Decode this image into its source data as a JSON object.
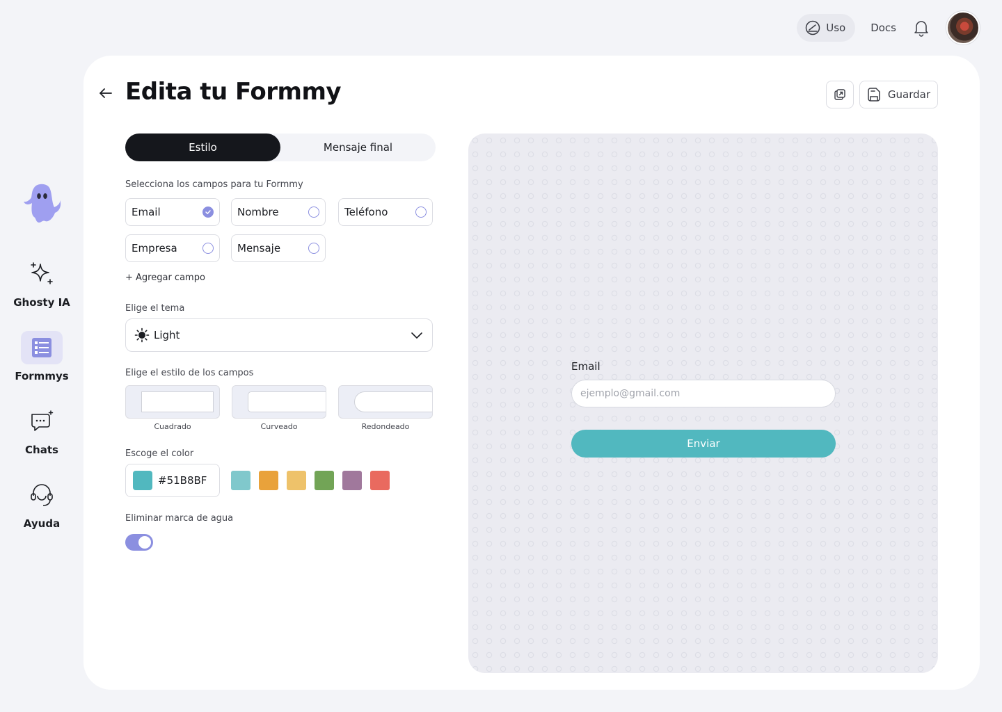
{
  "topbar": {
    "uso_label": "Uso",
    "docs_label": "Docs"
  },
  "sidebar": {
    "items": [
      {
        "label": "Ghosty IA",
        "icon": "sparkles-icon"
      },
      {
        "label": "Formmys",
        "icon": "list-icon",
        "active": true
      },
      {
        "label": "Chats",
        "icon": "chat-icon"
      },
      {
        "label": "Ayuda",
        "icon": "headset-icon"
      }
    ]
  },
  "header": {
    "title": "Edita tu Formmy",
    "save_label": "Guardar"
  },
  "tabs": [
    {
      "label": "Estilo",
      "active": true
    },
    {
      "label": "Mensaje final",
      "active": false
    }
  ],
  "fields": {
    "label": "Selecciona los campos para tu Formmy",
    "options": [
      {
        "label": "Email",
        "checked": true
      },
      {
        "label": "Nombre",
        "checked": false
      },
      {
        "label": "Teléfono",
        "checked": false
      },
      {
        "label": "Empresa",
        "checked": false
      },
      {
        "label": "Mensaje",
        "checked": false
      }
    ],
    "add_label": "+ Agregar campo"
  },
  "theme": {
    "label": "Elige el tema",
    "value": "Light"
  },
  "field_style": {
    "label": "Elige el estilo de los campos",
    "options": [
      "Cuadrado",
      "Curveado",
      "Redondeado"
    ]
  },
  "color": {
    "label": "Escoge el color",
    "value": "#51B8BF",
    "swatches": [
      "#80c8cc",
      "#e9a23b",
      "#eec26a",
      "#72a456",
      "#a0789c",
      "#e96a5f"
    ]
  },
  "watermark": {
    "label": "Eliminar marca de agua",
    "enabled": true
  },
  "preview": {
    "email_label": "Email",
    "email_placeholder": "ejemplo@gmail.com",
    "submit_label": "Enviar",
    "accent": "#51B8BF"
  }
}
